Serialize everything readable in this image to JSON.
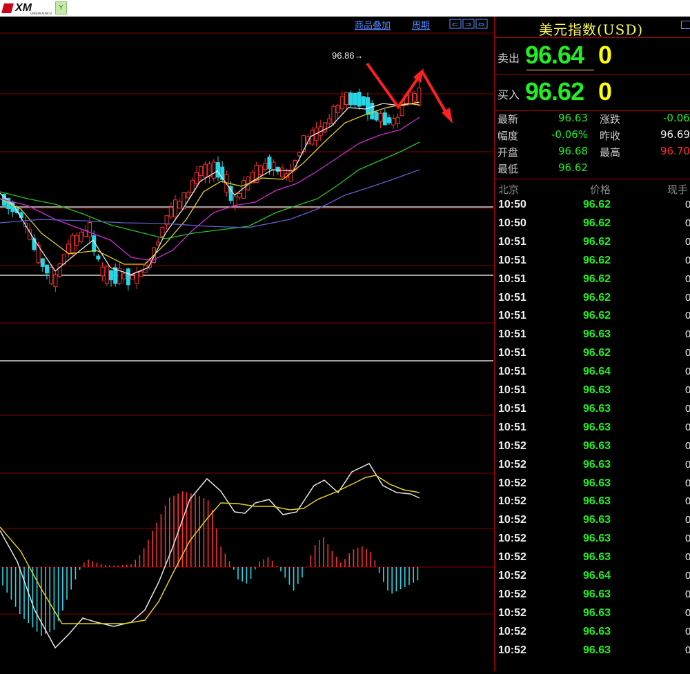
{
  "app": {
    "logo_text": "XM",
    "logo_sub": "GREENLAUNCH"
  },
  "toolbar": {
    "overlay_label": "商品叠加",
    "period_label": "周期"
  },
  "chart": {
    "peak_label": "96.86→"
  },
  "panel": {
    "title": "美元指数(USD)",
    "sell": {
      "label": "卖出",
      "price": "96.64",
      "volume": "0"
    },
    "buy": {
      "label": "买入",
      "price": "96.62",
      "volume": "0"
    },
    "stats": {
      "latest_label": "最新",
      "latest": "96.63",
      "change_label": "涨跌",
      "change": "-0.06",
      "amplitude_label": "幅度",
      "amplitude": "-0.06%",
      "prev_close_label": "昨收",
      "prev_close": "96.69",
      "open_label": "开盘",
      "open": "96.68",
      "high_label": "最高",
      "high": "96.70",
      "low_label": "最低",
      "low": "96.62"
    },
    "ticks_header": {
      "time": "北京",
      "price": "价格",
      "volume": "现手"
    },
    "ticks": [
      {
        "t": "10:50",
        "p": "96.62",
        "v": "0"
      },
      {
        "t": "10:50",
        "p": "96.62",
        "v": "0"
      },
      {
        "t": "10:51",
        "p": "96.62",
        "v": "0"
      },
      {
        "t": "10:51",
        "p": "96.62",
        "v": "0"
      },
      {
        "t": "10:51",
        "p": "96.62",
        "v": "0"
      },
      {
        "t": "10:51",
        "p": "96.62",
        "v": "0"
      },
      {
        "t": "10:51",
        "p": "96.62",
        "v": "0"
      },
      {
        "t": "10:51",
        "p": "96.63",
        "v": "0"
      },
      {
        "t": "10:51",
        "p": "96.62",
        "v": "0"
      },
      {
        "t": "10:51",
        "p": "96.64",
        "v": "0"
      },
      {
        "t": "10:51",
        "p": "96.63",
        "v": "0"
      },
      {
        "t": "10:51",
        "p": "96.63",
        "v": "0"
      },
      {
        "t": "10:51",
        "p": "96.63",
        "v": "0"
      },
      {
        "t": "10:52",
        "p": "96.63",
        "v": "0"
      },
      {
        "t": "10:52",
        "p": "96.63",
        "v": "0"
      },
      {
        "t": "10:52",
        "p": "96.63",
        "v": "0"
      },
      {
        "t": "10:52",
        "p": "96.63",
        "v": "0"
      },
      {
        "t": "10:52",
        "p": "96.63",
        "v": "0"
      },
      {
        "t": "10:52",
        "p": "96.63",
        "v": "0"
      },
      {
        "t": "10:52",
        "p": "96.63",
        "v": "0"
      },
      {
        "t": "10:52",
        "p": "96.64",
        "v": "0"
      },
      {
        "t": "10:52",
        "p": "96.63",
        "v": "0"
      },
      {
        "t": "10:52",
        "p": "96.63",
        "v": "0"
      },
      {
        "t": "10:52",
        "p": "96.63",
        "v": "0"
      },
      {
        "t": "10:52",
        "p": "96.63",
        "v": "0"
      }
    ]
  },
  "colors": {
    "up": "#ff3030",
    "down": "#25d7e6",
    "ma5": "#e8e8e8",
    "ma10": "#e5d21a",
    "ma20": "#d02ad6",
    "ma30": "#21c81e",
    "ma60": "#6060d0",
    "grid": "#8a0000"
  }
}
